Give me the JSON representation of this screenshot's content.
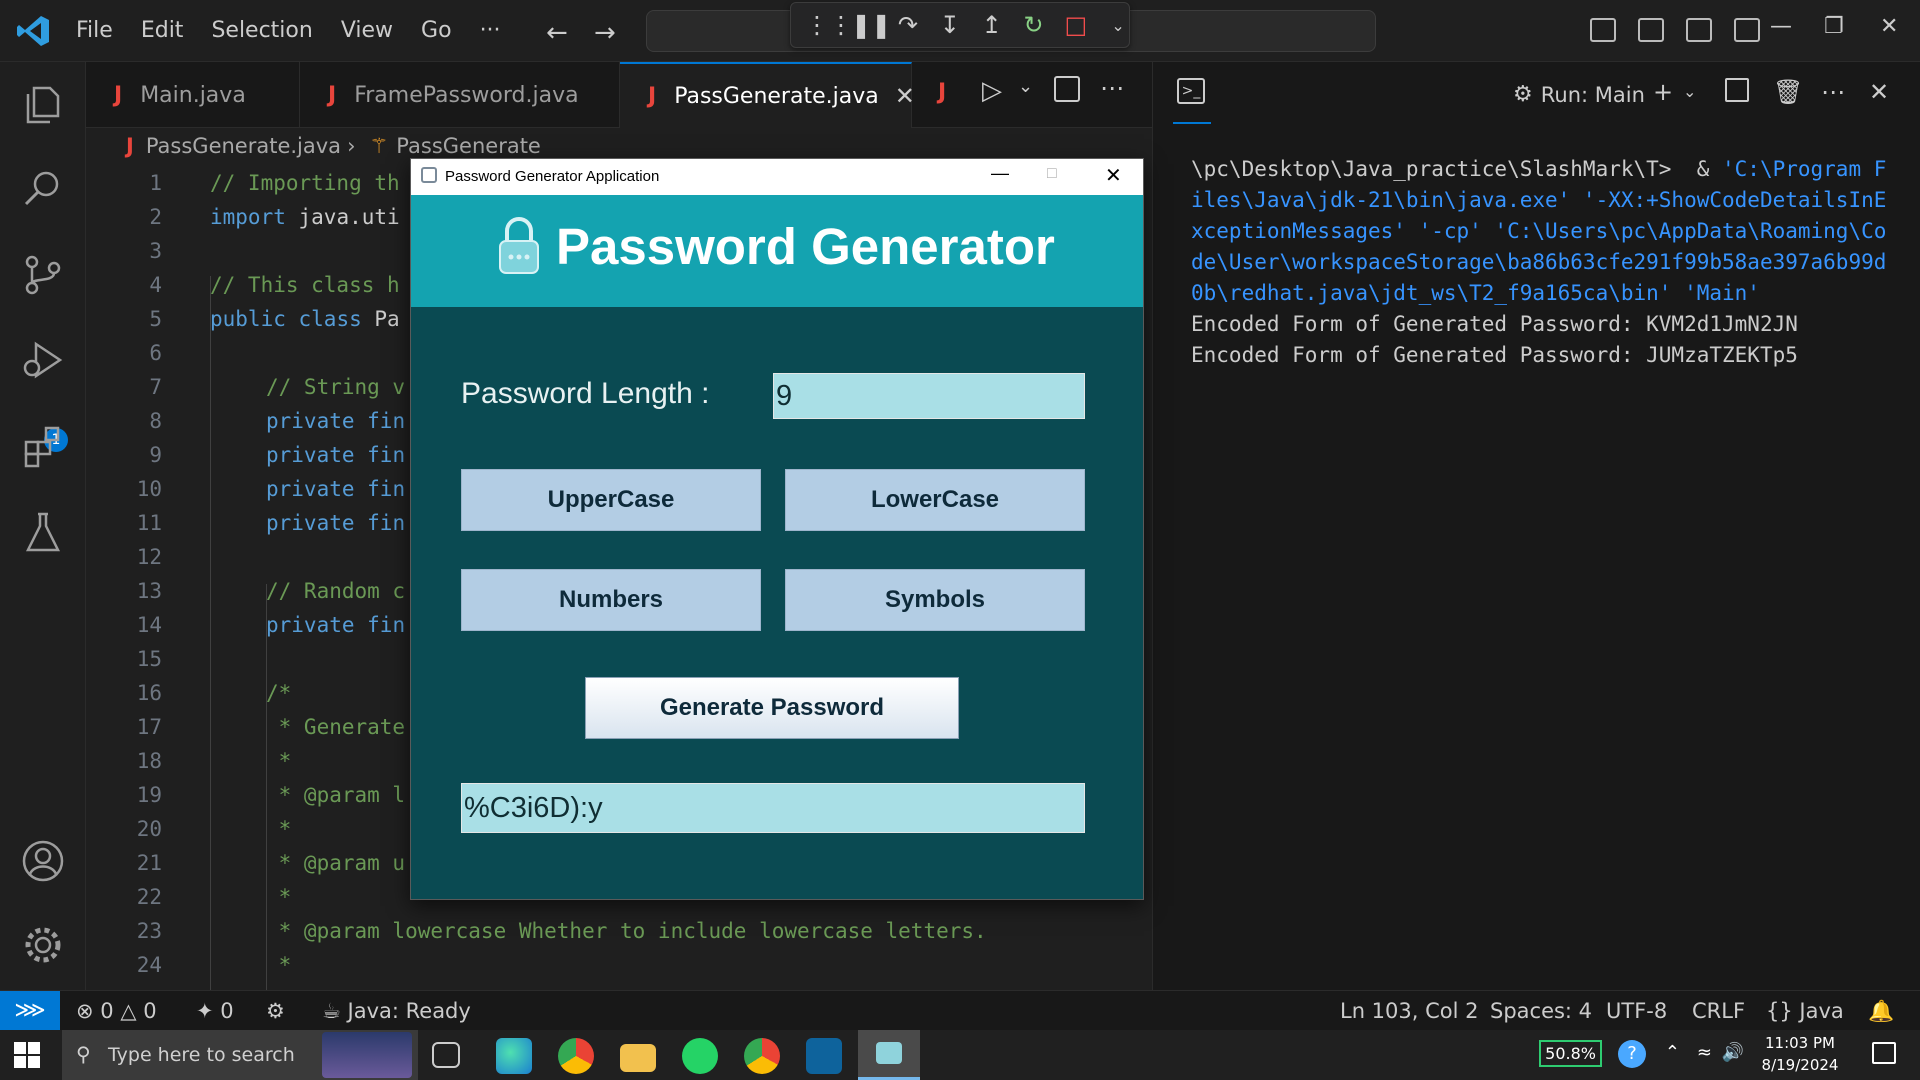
{
  "menu": [
    "File",
    "Edit",
    "Selection",
    "View",
    "Go",
    "···"
  ],
  "tabs": [
    {
      "label": "Main.java"
    },
    {
      "label": "FramePassword.java"
    },
    {
      "label": "PassGenerate.java",
      "active": true
    }
  ],
  "breadcrumb": {
    "file": "PassGenerate.java",
    "symbol": "PassGenerate"
  },
  "code_lines": [
    {
      "n": "1",
      "text": "// Importing th",
      "kind": "cmt",
      "indent": 0
    },
    {
      "n": "2",
      "text": "import java.uti",
      "kind": "import",
      "indent": 0
    },
    {
      "n": "3",
      "text": "",
      "kind": "plain",
      "indent": 0
    },
    {
      "n": "4",
      "text": "// This class h",
      "kind": "cmt",
      "indent": 0
    },
    {
      "n": "5",
      "text": "public class Pa",
      "kind": "class",
      "indent": 0
    },
    {
      "n": "6",
      "text": "",
      "kind": "plain",
      "indent": 0
    },
    {
      "n": "7",
      "text": "// String v",
      "kind": "cmt",
      "indent": 1
    },
    {
      "n": "8",
      "text": "private fin",
      "kind": "private",
      "indent": 1
    },
    {
      "n": "9",
      "text": "private fin",
      "kind": "private",
      "indent": 1
    },
    {
      "n": "10",
      "text": "private fin",
      "kind": "private",
      "indent": 1
    },
    {
      "n": "11",
      "text": "private fin",
      "kind": "private",
      "indent": 1
    },
    {
      "n": "12",
      "text": "",
      "kind": "plain",
      "indent": 1
    },
    {
      "n": "13",
      "text": "// Random c",
      "kind": "cmt",
      "indent": 1
    },
    {
      "n": "14",
      "text": "private fin",
      "kind": "private",
      "indent": 1
    },
    {
      "n": "15",
      "text": "",
      "kind": "plain",
      "indent": 1
    },
    {
      "n": "16",
      "text": "/*",
      "kind": "cmt",
      "indent": 1
    },
    {
      "n": "17",
      "text": " * Generate",
      "kind": "cmt",
      "indent": 1
    },
    {
      "n": "18",
      "text": " *",
      "kind": "cmt",
      "indent": 1
    },
    {
      "n": "19",
      "text": " * @param l",
      "kind": "cmt",
      "indent": 1
    },
    {
      "n": "20",
      "text": " *",
      "kind": "cmt",
      "indent": 1
    },
    {
      "n": "21",
      "text": " * @param u",
      "kind": "cmt",
      "indent": 1
    },
    {
      "n": "22",
      "text": " *",
      "kind": "cmt",
      "indent": 1
    },
    {
      "n": "23",
      "text": " * @param lowercase Whether to include lowercase letters.",
      "kind": "cmt",
      "indent": 1
    },
    {
      "n": "24",
      "text": " *",
      "kind": "cmt",
      "indent": 1
    }
  ],
  "terminal": {
    "run_label": "Run: Main",
    "prompt": "\\pc\\Desktop\\Java_practice\\SlashMark\\T>  & ",
    "command": "'C:\\Program Files\\Java\\jdk-21\\bin\\java.exe' '-XX:+ShowCodeDetailsInExceptionMessages' '-cp' 'C:\\Users\\pc\\AppData\\Roaming\\Code\\User\\workspaceStorage\\ba86b63cfe291f99b58ae397a6b99d0b\\redhat.java\\jdt_ws\\T2_f9a165ca\\bin' 'Main'",
    "output": [
      "Encoded Form of Generated Password: KVM2d1JmN2JN",
      "Encoded Form of Generated Password: JUMzaTZEKTp5"
    ]
  },
  "dialog": {
    "window_title": "Password Generator Application",
    "heading": "Password Generator",
    "length_label": "Password Length :",
    "length_value": "9",
    "btn_upper": "UpperCase",
    "btn_lower": "LowerCase",
    "btn_numbers": "Numbers",
    "btn_symbols": "Symbols",
    "btn_generate": "Generate Password",
    "result": "%C3i6D):y",
    "colors": {
      "header": "#14a3b0",
      "body": "#0a4a52",
      "field": "#a9dfe6",
      "button": "#b3cde4"
    }
  },
  "status": {
    "errors": "0",
    "warnings": "0",
    "ports": "0",
    "java": "Java: Ready",
    "position": "Ln 103, Col 2",
    "spaces": "Spaces: 4",
    "encoding": "UTF-8",
    "eol": "CRLF",
    "language": "Java"
  },
  "activity_badge": "1",
  "taskbar": {
    "search_placeholder": "Type here to search",
    "battery": "50.8%",
    "time": "11:03 PM",
    "date": "8/19/2024"
  },
  "accent": "#0078d4"
}
